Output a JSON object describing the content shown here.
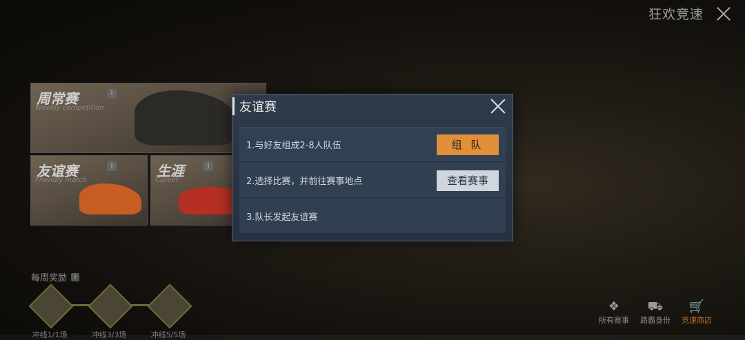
{
  "header": {
    "title": "狂欢竞速"
  },
  "modes": [
    {
      "label": "周常赛",
      "sub": "Weekly competition",
      "info": "i"
    },
    {
      "label": "友谊赛",
      "sub": "Friendly match",
      "info": "i"
    },
    {
      "label": "生涯",
      "sub": "Career",
      "info": "i"
    }
  ],
  "weekly_rewards": {
    "title": "每周奖励",
    "info": "i",
    "items": [
      {
        "label": "冲线1/1场"
      },
      {
        "label": "冲线3/3场"
      },
      {
        "label": "冲线5/5场"
      }
    ]
  },
  "bottom_nav": [
    {
      "label": "所有赛事",
      "icon": "grid-icon",
      "glyph": "❖"
    },
    {
      "label": "路霸身份",
      "icon": "car-icon",
      "glyph": "⛟"
    },
    {
      "label": "竞速商店",
      "icon": "cart-icon",
      "glyph": "🛒",
      "active": true
    }
  ],
  "dialog": {
    "title": "友谊赛",
    "steps": [
      {
        "text": "1.与好友组成2-8人队伍",
        "button": "组 队"
      },
      {
        "text": "2.选择比赛，并前往赛事地点",
        "button": "查看赛事"
      },
      {
        "text": "3.队长发起友谊赛"
      }
    ]
  },
  "colors": {
    "accent": "#e08f3b",
    "dialog_bg": "#2b3645",
    "secondary_button": "#cfd6de"
  }
}
